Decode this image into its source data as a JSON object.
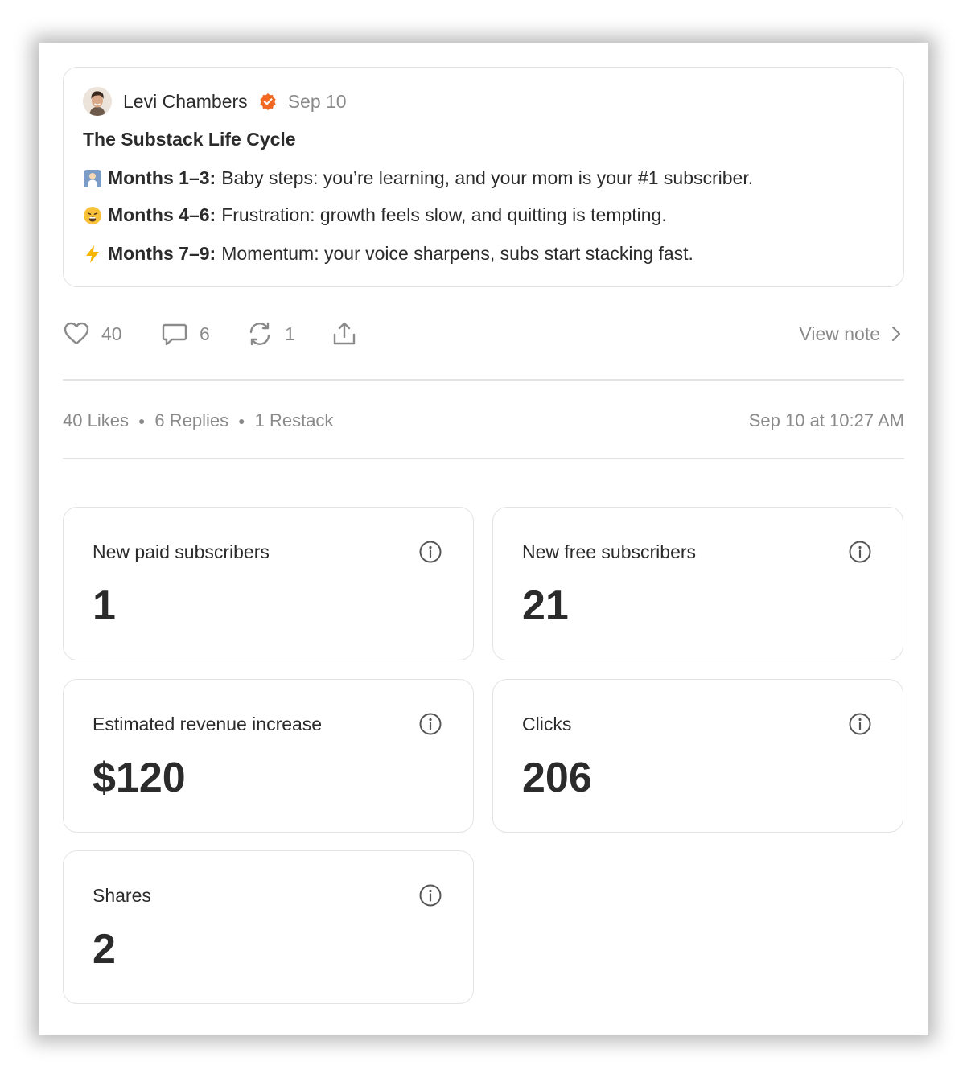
{
  "note": {
    "author": "Levi Chambers",
    "date": "Sep 10",
    "title": "The Substack Life Cycle",
    "lines": [
      {
        "emoji": "baby-emoji",
        "label": "Months 1–3:",
        "text": "Baby steps: you’re learning, and your mom is your #1 subscriber."
      },
      {
        "emoji": "weary-face-emoji",
        "label": "Months 4–6:",
        "text": "Frustration: growth feels slow, and quitting is tempting."
      },
      {
        "emoji": "lightning-emoji",
        "label": "Months 7–9:",
        "text": "Momentum: your voice sharpens, subs start stacking fast."
      }
    ]
  },
  "actions": {
    "likes": "40",
    "replies": "6",
    "restacks": "1",
    "view_note": "View note"
  },
  "stats": {
    "likes": "40 Likes",
    "replies": "6 Replies",
    "restacks": "1 Restack",
    "timestamp": "Sep 10 at 10:27 AM"
  },
  "metrics": [
    {
      "label": "New paid subscribers",
      "value": "1"
    },
    {
      "label": "New free subscribers",
      "value": "21"
    },
    {
      "label": "Estimated revenue increase",
      "value": "$120"
    },
    {
      "label": "Clicks",
      "value": "206"
    },
    {
      "label": "Shares",
      "value": "2"
    }
  ],
  "colors": {
    "verified_badge": "#f26722",
    "border": "#e3e3e3",
    "muted_text": "#8a8a8a",
    "text": "#2b2b2b"
  }
}
